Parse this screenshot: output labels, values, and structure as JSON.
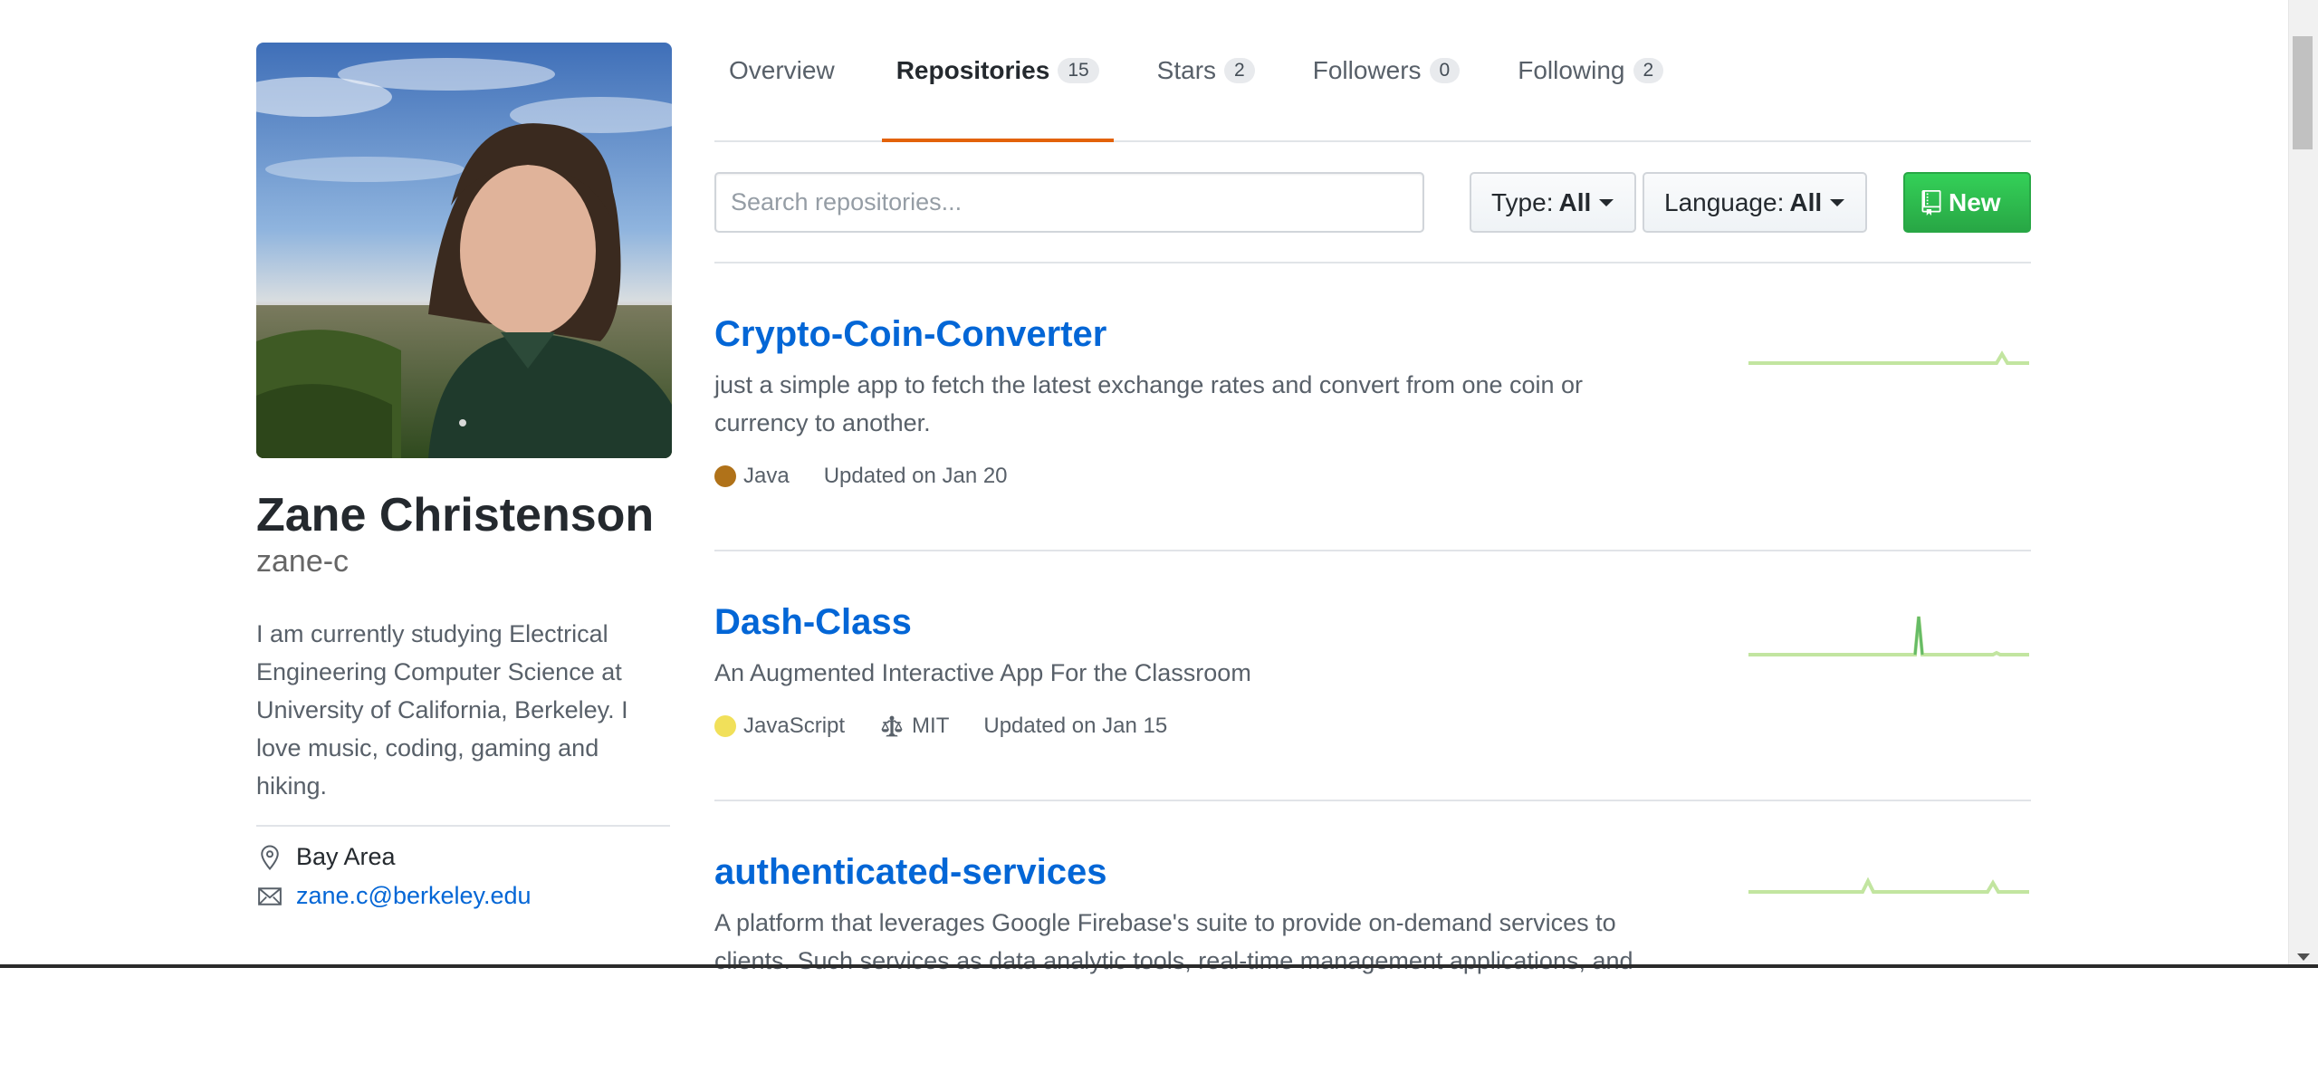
{
  "profile": {
    "full_name": "Zane Christenson",
    "username": "zane-c",
    "bio": "I am currently studying Electrical Engineering Computer Science at University of California, Berkeley. I love music, coding, gaming and hiking.",
    "location": "Bay Area",
    "email": "zane.c@berkeley.edu"
  },
  "tabs": [
    {
      "label": "Overview",
      "count": null
    },
    {
      "label": "Repositories",
      "count": "15",
      "selected": true
    },
    {
      "label": "Stars",
      "count": "2"
    },
    {
      "label": "Followers",
      "count": "0"
    },
    {
      "label": "Following",
      "count": "2"
    }
  ],
  "filters": {
    "search_placeholder": "Search repositories...",
    "type_label": "Type:",
    "type_value": "All",
    "language_label": "Language:",
    "language_value": "All",
    "new_label": "New"
  },
  "repos": [
    {
      "name": "Crypto-Coin-Converter",
      "description": "just a simple app to fetch the latest exchange rates and convert from one coin or currency to another.",
      "language": "Java",
      "language_color": "#b07219",
      "license": null,
      "updated": "Updated on Jan 20"
    },
    {
      "name": "Dash-Class",
      "description": "An Augmented Interactive App For the Classroom",
      "language": "JavaScript",
      "language_color": "#f1e05a",
      "license": "MIT",
      "updated": "Updated on Jan 15"
    },
    {
      "name": "authenticated-services",
      "description": "A platform that leverages Google Firebase's suite to provide on-demand services to clients. Such services as data analytic tools, real-time management applications, and"
    }
  ],
  "colors": {
    "link": "#0366d6",
    "tab_underline": "#e36209",
    "new_button": "#28a745",
    "sparkline": "#c2e5a0"
  }
}
